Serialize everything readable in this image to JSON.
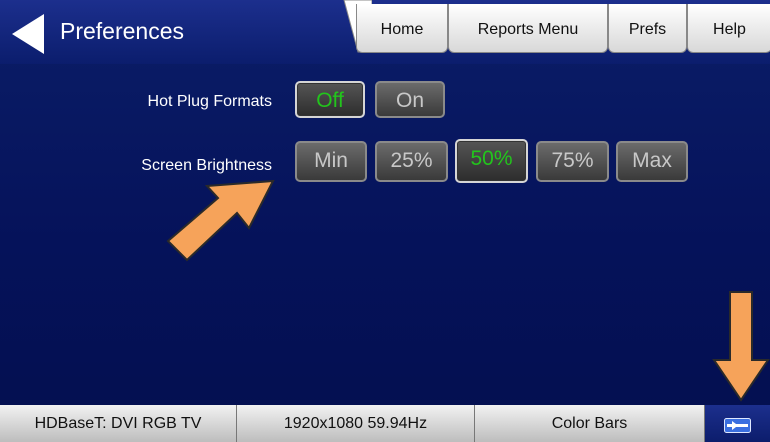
{
  "header": {
    "title": "Preferences",
    "tabs": {
      "home": "Home",
      "reports": "Reports Menu",
      "prefs": "Prefs",
      "help": "Help"
    }
  },
  "settings": {
    "hot_plug": {
      "label": "Hot Plug Formats",
      "options": [
        "Off",
        "On"
      ],
      "selected": "Off"
    },
    "brightness": {
      "label": "Screen Brightness",
      "options": [
        "Min",
        "25%",
        "50%",
        "75%",
        "Max"
      ],
      "selected": "50%"
    }
  },
  "status_bar": {
    "interface": "HDBaseT: DVI RGB TV",
    "format": "1920x1080 59.94Hz",
    "pattern": "Color Bars",
    "icon": "usb-plug-icon"
  },
  "colors": {
    "selected_text": "#22c51c",
    "annotation_arrow": "#f6a35a"
  }
}
